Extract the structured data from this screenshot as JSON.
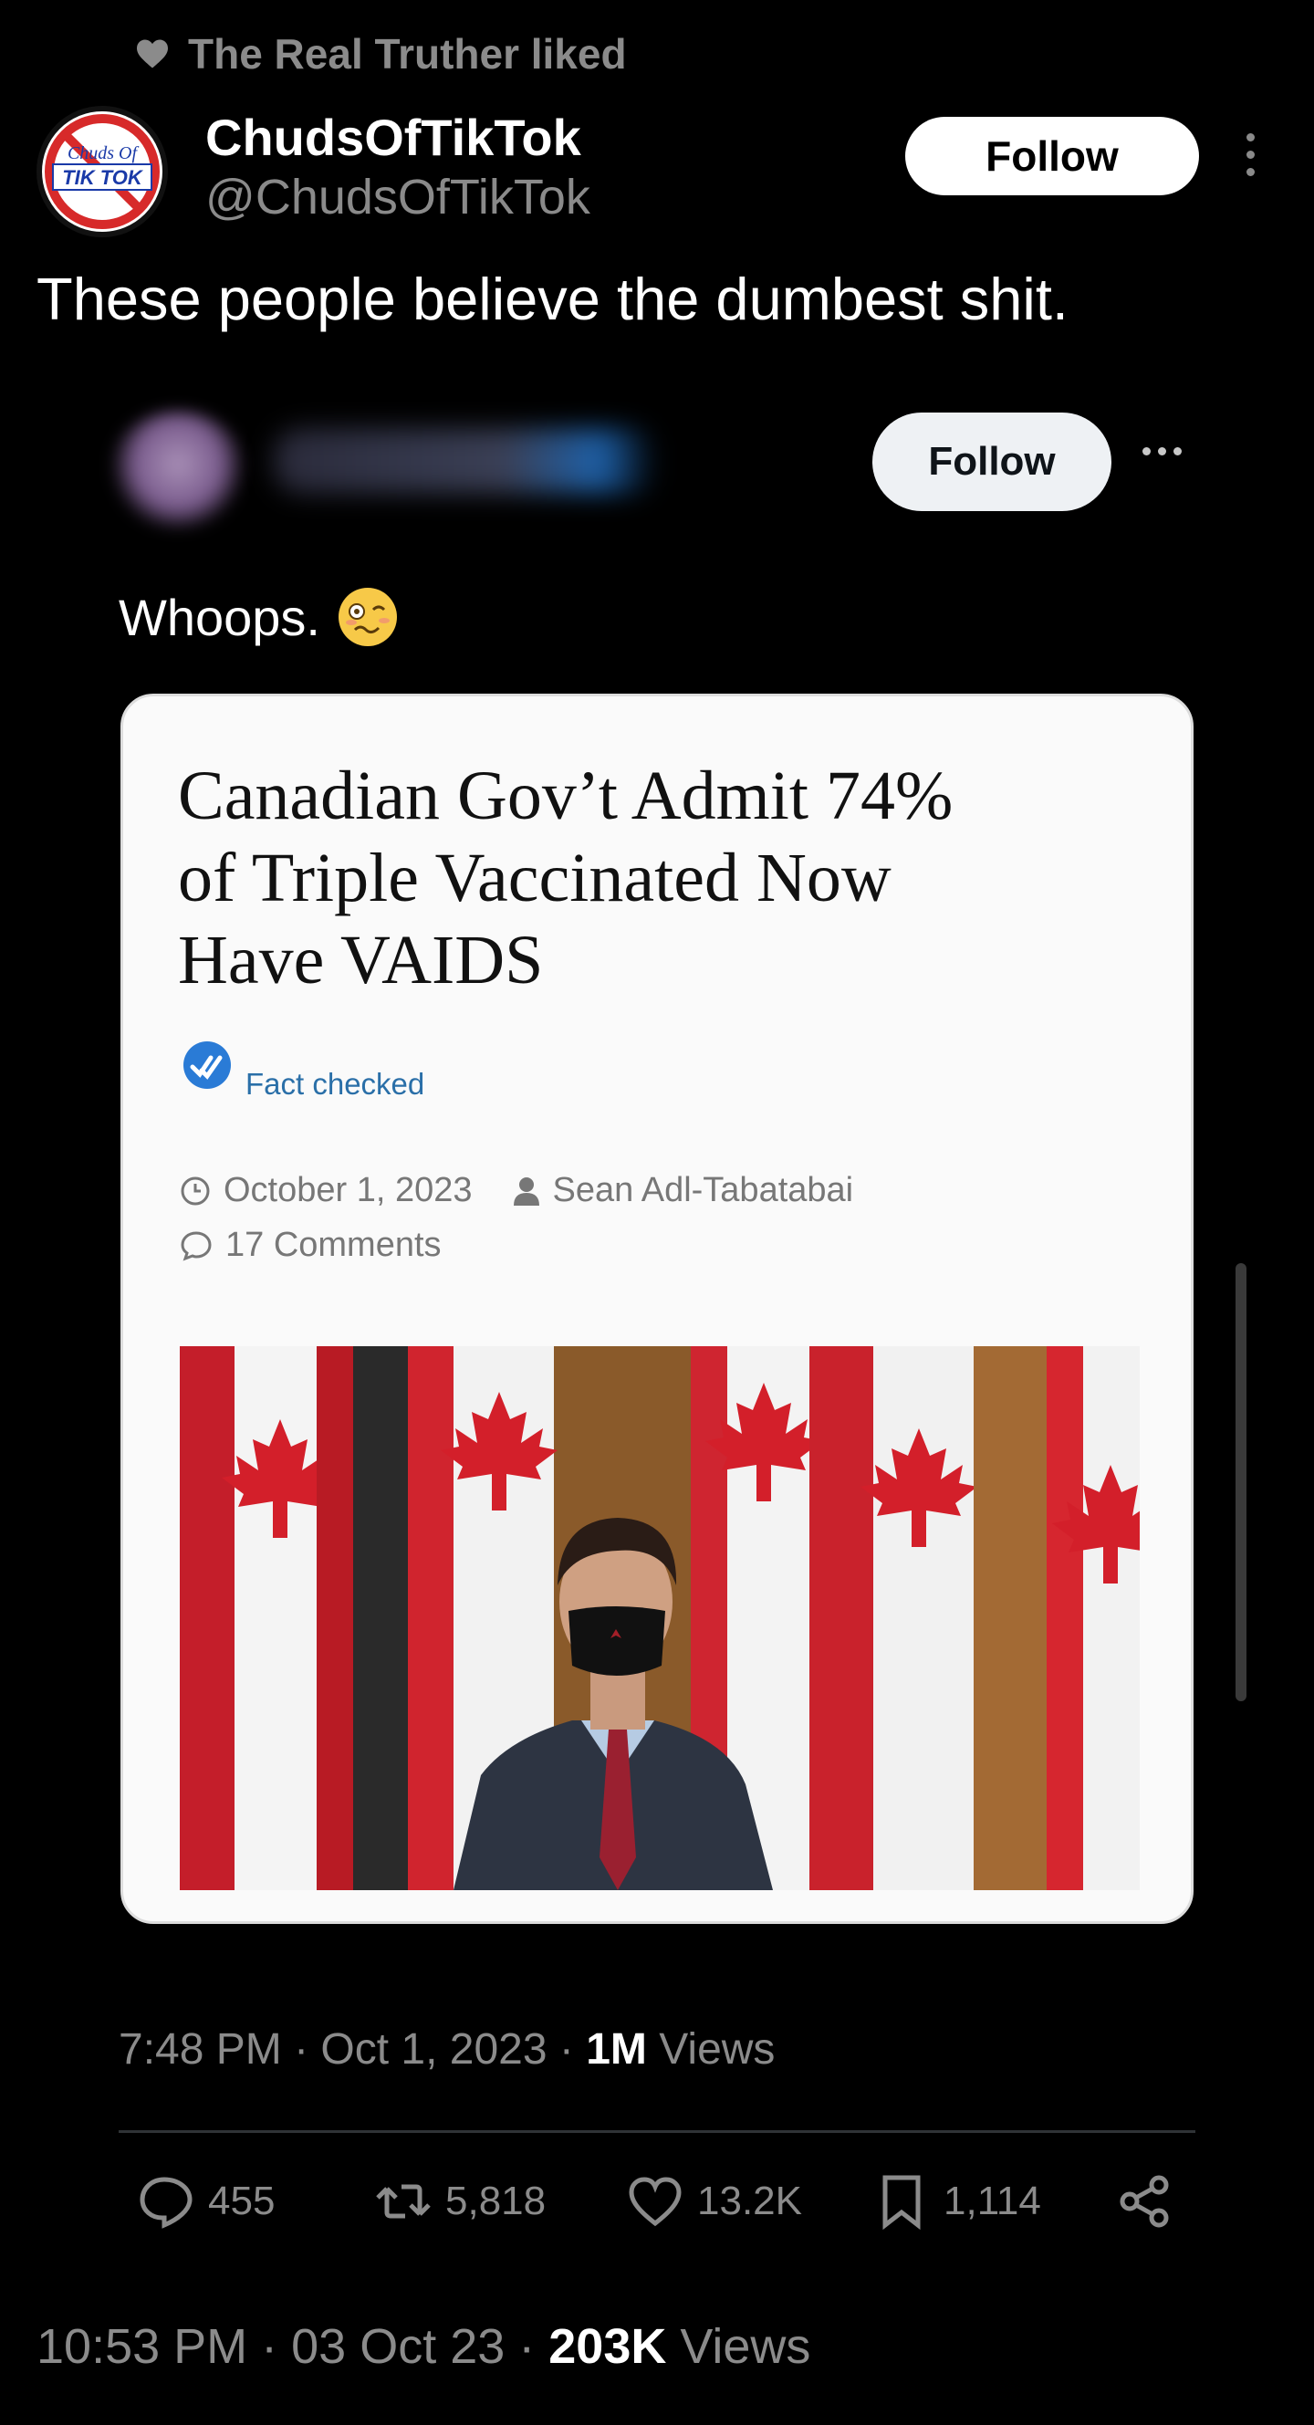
{
  "social_context": {
    "icon": "heart-icon",
    "text": "The Real Truther liked"
  },
  "author": {
    "display_name": "ChudsOfTikTok",
    "handle": "@ChudsOfTikTok",
    "avatar_text_top": "Chuds Of",
    "avatar_text_bottom": "TIK TOK",
    "follow_label": "Follow"
  },
  "tweet": {
    "text": "These people believe the dumbest shit."
  },
  "quoted_post": {
    "follow_label": "Follow",
    "text": "Whoops.",
    "emoji": "woozy-face-icon",
    "article": {
      "headline_line1": "Canadian Gov’t Admit 74%",
      "headline_line2": "of Triple Vaccinated Now",
      "headline_line3": "Have VAIDS",
      "fact_label": "Fact checked",
      "date": "October 1, 2023",
      "author": "Sean Adl-Tabatabai",
      "comments": "17 Comments"
    },
    "timestamp": "7:48 PM · Oct 1, 2023 · ",
    "views_count": "1M",
    "views_label": " Views",
    "stats": {
      "replies": "455",
      "reposts": "5,818",
      "likes": "13.2K",
      "bookmarks": "1,114"
    }
  },
  "footer": {
    "timestamp": "10:53 PM · 03 Oct 23 · ",
    "views_count": "203K",
    "views_label": " Views"
  },
  "colors": {
    "background": "#000000",
    "muted": "#8b8b8b",
    "link_blue": "#2a6fa8"
  }
}
